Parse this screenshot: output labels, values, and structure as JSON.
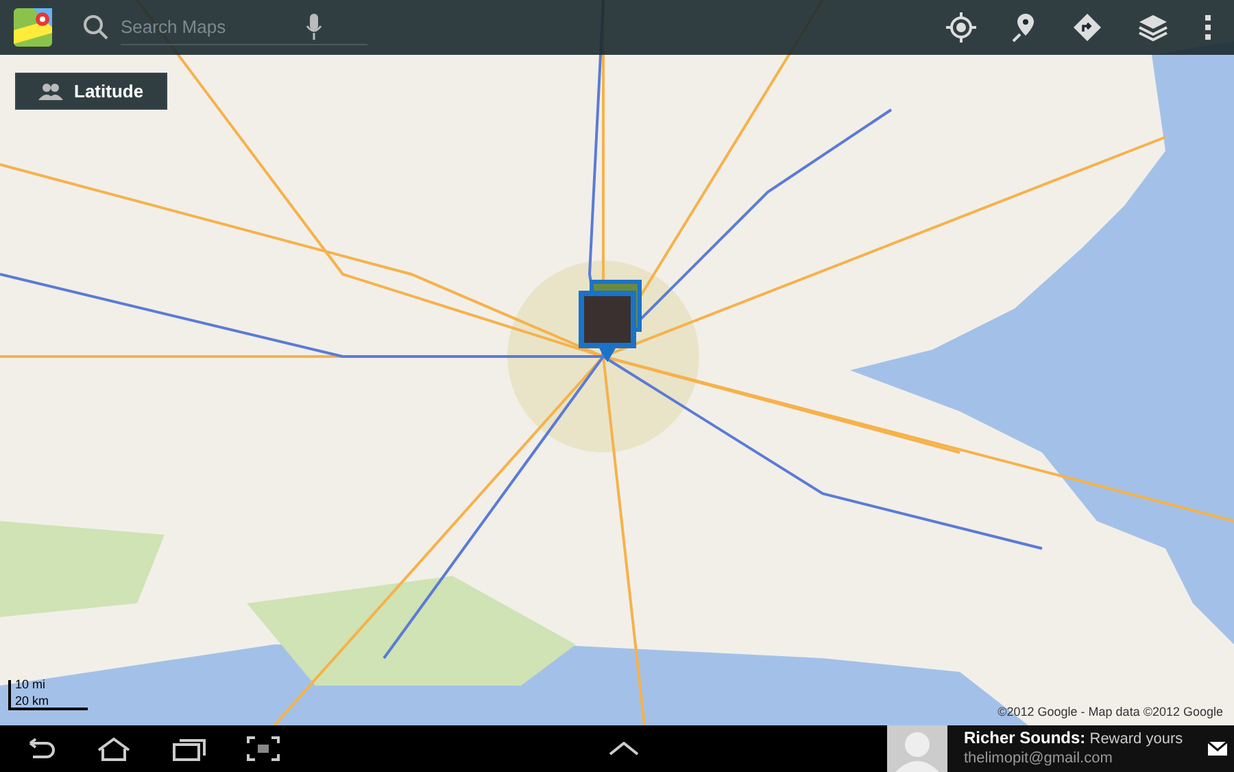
{
  "search": {
    "placeholder": "Search Maps"
  },
  "latitude_button": {
    "label": "Latitude"
  },
  "scale": {
    "miles": "10 mi",
    "km": "20 km"
  },
  "attribution": "©2012 Google - Map data ©2012 Google",
  "notification": {
    "title": "Richer Sounds:",
    "message": "Reward yours",
    "account": "thelimopit@gmail.com"
  }
}
